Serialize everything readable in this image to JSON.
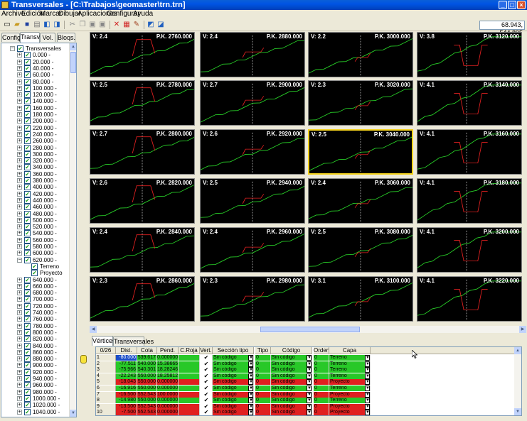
{
  "window": {
    "title": "Transversales - [C:\\Trabajos\\geomaster\\trn.trn]",
    "min_glyph": "_",
    "max_glyph": "□",
    "close_glyph": "×"
  },
  "menu": [
    "Archivo",
    "Edición",
    "Marcar",
    "Dibujar",
    "Aplicaciones",
    "Configurar",
    "Ayuda"
  ],
  "toolbar": {
    "icons": [
      "new-file-icon",
      "open-folder-icon",
      "save-icon",
      "print-icon",
      "import-icon",
      "export-icon",
      "cut-icon",
      "copy-icon",
      "paste-icon",
      "paste-special-icon",
      "delete-marks-icon",
      "mark-table-icon",
      "pencil-icon",
      "config-a-icon",
      "config-b-icon"
    ],
    "coords": "68.943, 544.805"
  },
  "left_tabs": [
    "Config.",
    "Transv.",
    "Vol.",
    "Bloqs."
  ],
  "tree": {
    "root_label": "Transversales",
    "items": [
      "0.000 -",
      "20.000 -",
      "40.000 -",
      "60.000 -",
      "80.000 -",
      "100.000 -",
      "120.000 -",
      "140.000 -",
      "160.000 -",
      "180.000 -",
      "200.000 -",
      "220.000 -",
      "240.000 -",
      "260.000 -",
      "280.000 -",
      "300.000 -",
      "320.000 -",
      "340.000 -",
      "360.000 -",
      "380.000 -",
      "400.000 -",
      "420.000 -",
      "440.000 -",
      "460.000 -",
      "480.000 -",
      "500.000 -",
      "520.000 -",
      "540.000 -",
      "560.000 -",
      "580.000 -",
      "600.000 -",
      "620.000 -"
    ],
    "expanded_children": [
      "Terreno",
      "Proyecto"
    ],
    "items_after": [
      "640.000 -",
      "660.000 -",
      "680.000 -",
      "700.000 -",
      "720.000 -",
      "740.000 -",
      "760.000 -",
      "780.000 -",
      "800.000 -",
      "820.000 -",
      "840.000 -",
      "860.000 -",
      "880.000 -",
      "900.000 -",
      "920.000 -",
      "940.000 -",
      "960.000 -",
      "980.000 -",
      "1000.000 -",
      "1020.000 -",
      "1040.000 -"
    ]
  },
  "sections": [
    [
      {
        "v": "V: 2.4",
        "pk": "P.K. 2760.000"
      },
      {
        "v": "V: 2.4",
        "pk": "P.K. 2880.000"
      },
      {
        "v": "V: 2.2",
        "pk": "P.K. 3000.000"
      },
      {
        "v": "V: 3.8",
        "pk": "P.K. 3120.000"
      }
    ],
    [
      {
        "v": "V: 2.5",
        "pk": "P.K. 2780.000"
      },
      {
        "v": "V: 2.7",
        "pk": "P.K. 2900.000"
      },
      {
        "v": "V: 2.3",
        "pk": "P.K. 3020.000"
      },
      {
        "v": "V: 4.1",
        "pk": "P.K. 3140.000"
      }
    ],
    [
      {
        "v": "V: 2.7",
        "pk": "P.K. 2800.000"
      },
      {
        "v": "V: 2.6",
        "pk": "P.K. 2920.000"
      },
      {
        "v": "V: 2.5",
        "pk": "P.K. 3040.000"
      },
      {
        "v": "V: 4.1",
        "pk": "P.K. 3160.000"
      }
    ],
    [
      {
        "v": "V: 2.6",
        "pk": "P.K. 2820.000"
      },
      {
        "v": "V: 2.5",
        "pk": "P.K. 2940.000"
      },
      {
        "v": "V: 2.4",
        "pk": "P.K. 3060.000"
      },
      {
        "v": "V: 4.1",
        "pk": "P.K. 3180.000"
      }
    ],
    [
      {
        "v": "V: 2.4",
        "pk": "P.K. 2840.000"
      },
      {
        "v": "V: 2.4",
        "pk": "P.K. 2960.000"
      },
      {
        "v": "V: 2.5",
        "pk": "P.K. 3080.000"
      },
      {
        "v": "V: 4.1",
        "pk": "P.K. 3200.000"
      }
    ],
    [
      {
        "v": "V: 2.3",
        "pk": "P.K. 2860.000"
      },
      {
        "v": "V: 2.3",
        "pk": "P.K. 2980.000"
      },
      {
        "v": "V: 3.1",
        "pk": "P.K. 3100.000"
      },
      {
        "v": "V: 4.1",
        "pk": "P.K. 3220.000"
      }
    ]
  ],
  "bottom_tabs": [
    "Vértices",
    "Transversales"
  ],
  "grid": {
    "headers": [
      "0/26",
      "Dist.",
      "Cota",
      "Pend.",
      "C.Roja",
      "Vert.",
      "Sección tipo",
      "Tipo",
      "Código",
      "Orden",
      "Capa"
    ],
    "rows": [
      {
        "n": "1",
        "dist": "-80.000",
        "cota": "539.617",
        "pend": "0.000000",
        "roja": "",
        "vert": "✔",
        "sec": "Sin código",
        "tipo": "0",
        "cod": "Sin código",
        "orden": "0",
        "capa": "Terreno",
        "color": "#28c828"
      },
      {
        "n": "2",
        "dist": "-77.511",
        "cota": "540.000",
        "pend": "15.38665",
        "roja": "",
        "vert": "✔",
        "sec": "Sin código",
        "tipo": "0",
        "cod": "Sin código",
        "orden": "0",
        "capa": "Terreno",
        "color": "#28c828"
      },
      {
        "n": "3",
        "dist": "-75.966",
        "cota": "540.301",
        "pend": "18.28246",
        "roja": "",
        "vert": "✔",
        "sec": "Sin código",
        "tipo": "0",
        "cod": "Sin código",
        "orden": "0",
        "capa": "Terreno",
        "color": "#28c828"
      },
      {
        "n": "4",
        "dist": "-22.243",
        "cota": "550.000",
        "pend": "18.25812",
        "roja": "",
        "vert": "✔",
        "sec": "Sin código",
        "tipo": "0",
        "cod": "Sin código",
        "orden": "0",
        "capa": "Terreno",
        "color": "#28c828"
      },
      {
        "n": "5",
        "dist": "-18.043",
        "cota": "550.000",
        "pend": "0.000000",
        "roja": "",
        "vert": "✔",
        "sec": "Sin código",
        "tipo": "0",
        "cod": "Sin código",
        "orden": "0",
        "capa": "Proyecto",
        "color": "#e02020"
      },
      {
        "n": "6",
        "dist": "-16.916",
        "cota": "550.000",
        "pend": "0.000000",
        "roja": "",
        "vert": "✔",
        "sec": "Sin código",
        "tipo": "0",
        "cod": "Sin código",
        "orden": "0",
        "capa": "Terreno",
        "color": "#28c828"
      },
      {
        "n": "7",
        "dist": "-16.500",
        "cota": "552.543",
        "pend": "100.0000",
        "roja": "",
        "vert": "✔",
        "sec": "Sin código",
        "tipo": "0",
        "cod": "Sin código",
        "orden": "0",
        "capa": "Proyecto",
        "color": "#e02020"
      },
      {
        "n": "8",
        "dist": "-14.980",
        "cota": "550.000",
        "pend": "0.000000",
        "roja": "",
        "vert": "✔",
        "sec": "Sin código",
        "tipo": "0",
        "cod": "Sin código",
        "orden": "0",
        "capa": "Terreno",
        "color": "#28c828"
      },
      {
        "n": "9",
        "dist": "-13.500",
        "cota": "552.543",
        "pend": "0.000000",
        "roja": "",
        "vert": "✔",
        "sec": "Sin código",
        "tipo": "0",
        "cod": "Sin código",
        "orden": "0",
        "capa": "Proyecto",
        "color": "#e02020"
      },
      {
        "n": "10",
        "dist": "-7.500",
        "cota": "552.543",
        "pend": "0.000000",
        "roja": "",
        "vert": "✔",
        "sec": "Sin código",
        "tipo": "0",
        "cod": "Sin código",
        "orden": "0",
        "capa": "Proyecto",
        "color": "#e02020"
      }
    ]
  }
}
